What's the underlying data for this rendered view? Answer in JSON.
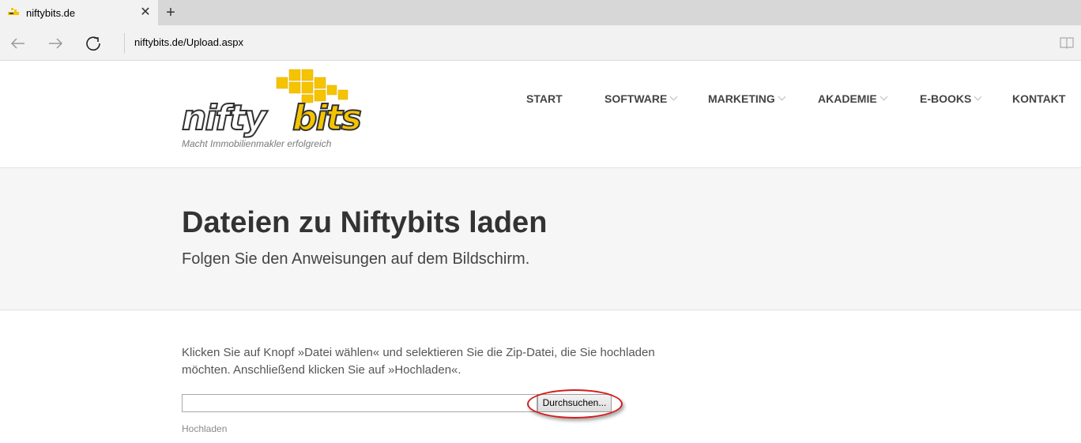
{
  "browser": {
    "tab_title": "niftybits.de",
    "close_glyph": "✕",
    "new_tab_glyph": "+",
    "address": "niftybits.de/Upload.aspx"
  },
  "site": {
    "tagline": "Macht Immobilienmakler erfolgreich",
    "logo_icon": "niftybits-logo",
    "menu": [
      {
        "label": "START"
      },
      {
        "label": "SOFTWARE"
      },
      {
        "label": "MARKETING"
      },
      {
        "label": "AKADEMIE"
      },
      {
        "label": "E-BOOKS"
      },
      {
        "label": "KONTAKT"
      }
    ]
  },
  "hero": {
    "title": "Dateien zu Niftybits laden",
    "subtitle": "Folgen Sie den Anweisungen auf dem Bildschirm."
  },
  "upload": {
    "instructions": "Klicken Sie auf Knopf »Datei wählen« und selektieren Sie die Zip-Datei, die Sie hochladen möchten. Anschließend klicken Sie auf »Hochladen«.",
    "file_value": "",
    "browse_label": "Durchsuchen...",
    "upload_label": "Hochladen"
  },
  "colors": {
    "brand_yellow": "#f5c400",
    "highlight_red": "#d41c1c"
  }
}
